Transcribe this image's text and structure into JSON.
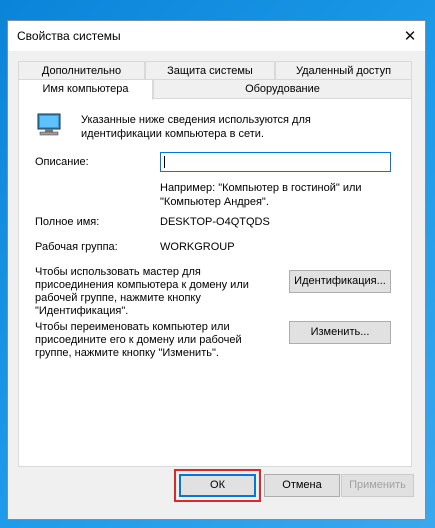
{
  "window": {
    "title": "Свойства системы"
  },
  "tabs": {
    "top_row": [
      "Дополнительно",
      "Защита системы",
      "Удаленный доступ"
    ],
    "bottom_row": [
      "Имя компьютера",
      "Оборудование"
    ],
    "active": "Имя компьютера"
  },
  "panel": {
    "intro_line1": "Указанные ниже сведения используются для",
    "intro_line2": "идентификации компьютера в сети.",
    "description_label": "Описание:",
    "description_value": "",
    "example_line1": "Например: \"Компьютер в гостиной\" или",
    "example_line2": "\"Компьютер Андрея\".",
    "full_name_label": "Полное имя:",
    "full_name_value": "DESKTOP-O4QTQDS",
    "workgroup_label": "Рабочая группа:",
    "workgroup_value": "WORKGROUP",
    "wizard_text": [
      "Чтобы использовать мастер для",
      "присоединения компьютера к домену или",
      "рабочей группе, нажмите кнопку",
      "\"Идентификация\"."
    ],
    "identify_button": "Идентификация...",
    "rename_text": [
      "Чтобы переименовать компьютер или",
      "присоедините его к домену или рабочей",
      "группе, нажмите кнопку \"Изменить\"."
    ],
    "change_button": "Изменить..."
  },
  "footer": {
    "ok": "ОК",
    "cancel": "Отмена",
    "apply": "Применить"
  },
  "colors": {
    "highlight": "#e1262b",
    "focus_blue": "#0078d7",
    "desktop": "#1e9bea"
  },
  "icons": {
    "close": "close-icon",
    "computer": "computer-icon"
  }
}
